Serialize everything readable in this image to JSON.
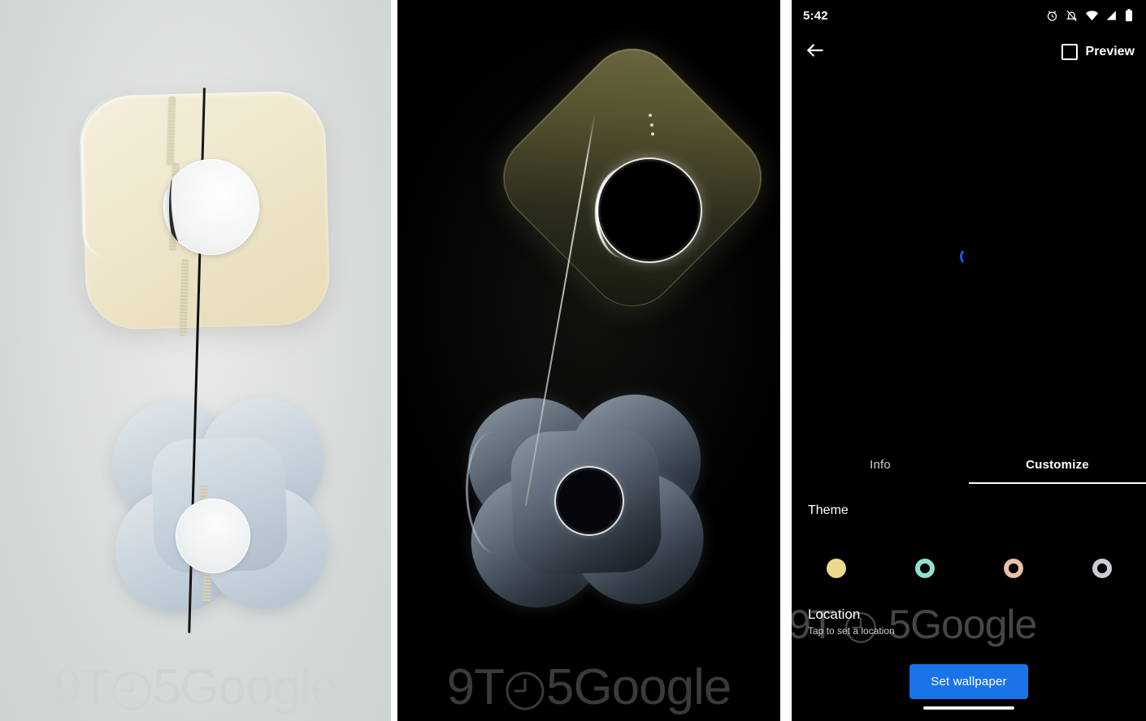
{
  "layout": {
    "panels": [
      {
        "id": "wallpaper-light-preview",
        "theme": "light"
      },
      {
        "id": "wallpaper-dark-preview",
        "theme": "dark"
      },
      {
        "id": "wallpaper-picker-phone-ui",
        "theme": "dark"
      }
    ]
  },
  "watermark": {
    "text_before": "9T",
    "clock_glyph": "clock-icon",
    "text_after": "5Google",
    "full_text": "9T┄5Google",
    "color_light": "#cfd4d3",
    "color_dark": "#3a3a3a",
    "color_ui": "#4a4a4a"
  },
  "phone": {
    "status_bar": {
      "time": "5:42",
      "icons": [
        {
          "name": "alarm-icon",
          "glyph": "alarm"
        },
        {
          "name": "notifications-off-icon",
          "glyph": "bell-muted"
        },
        {
          "name": "wifi-icon",
          "glyph": "wifi"
        },
        {
          "name": "cell-signal-icon",
          "glyph": "signal"
        },
        {
          "name": "battery-icon",
          "glyph": "battery"
        }
      ]
    },
    "app_bar": {
      "back_icon": "arrow-left-icon",
      "preview_checkbox": {
        "label": "Preview",
        "checked": false,
        "icon": "checkbox-unchecked-icon"
      }
    },
    "preview": {
      "loading_icon": "loading-spinner-icon",
      "spinner_color": "#1a56e8"
    },
    "tabs": [
      {
        "label": "Info",
        "active": false
      },
      {
        "label": "Customize",
        "active": true
      }
    ],
    "customize": {
      "theme_section_label": "Theme",
      "swatches": [
        {
          "name": "theme-swatch-cream",
          "color": "#ecd98f",
          "selected": true,
          "style": "filled"
        },
        {
          "name": "theme-swatch-teal",
          "color": "#8fe0cd",
          "selected": false,
          "style": "ring"
        },
        {
          "name": "theme-swatch-peach",
          "color": "#e8bfa8",
          "selected": false,
          "style": "ring"
        },
        {
          "name": "theme-swatch-gray",
          "color": "#c9ccd3",
          "selected": false,
          "style": "ring"
        }
      ],
      "location": {
        "title": "Location",
        "subtitle": "Tap to set a location"
      },
      "primary_action": {
        "label": "Set wallpaper",
        "color": "#1a73e8"
      }
    },
    "home_indicator": "home-indicator-bar"
  },
  "colors": {
    "light_bg": "#d8dcdb",
    "dark_bg": "#000000",
    "cream_square": "#efe8ce",
    "blue_flower": "#c2ccd8",
    "accent_blue": "#1a73e8"
  }
}
